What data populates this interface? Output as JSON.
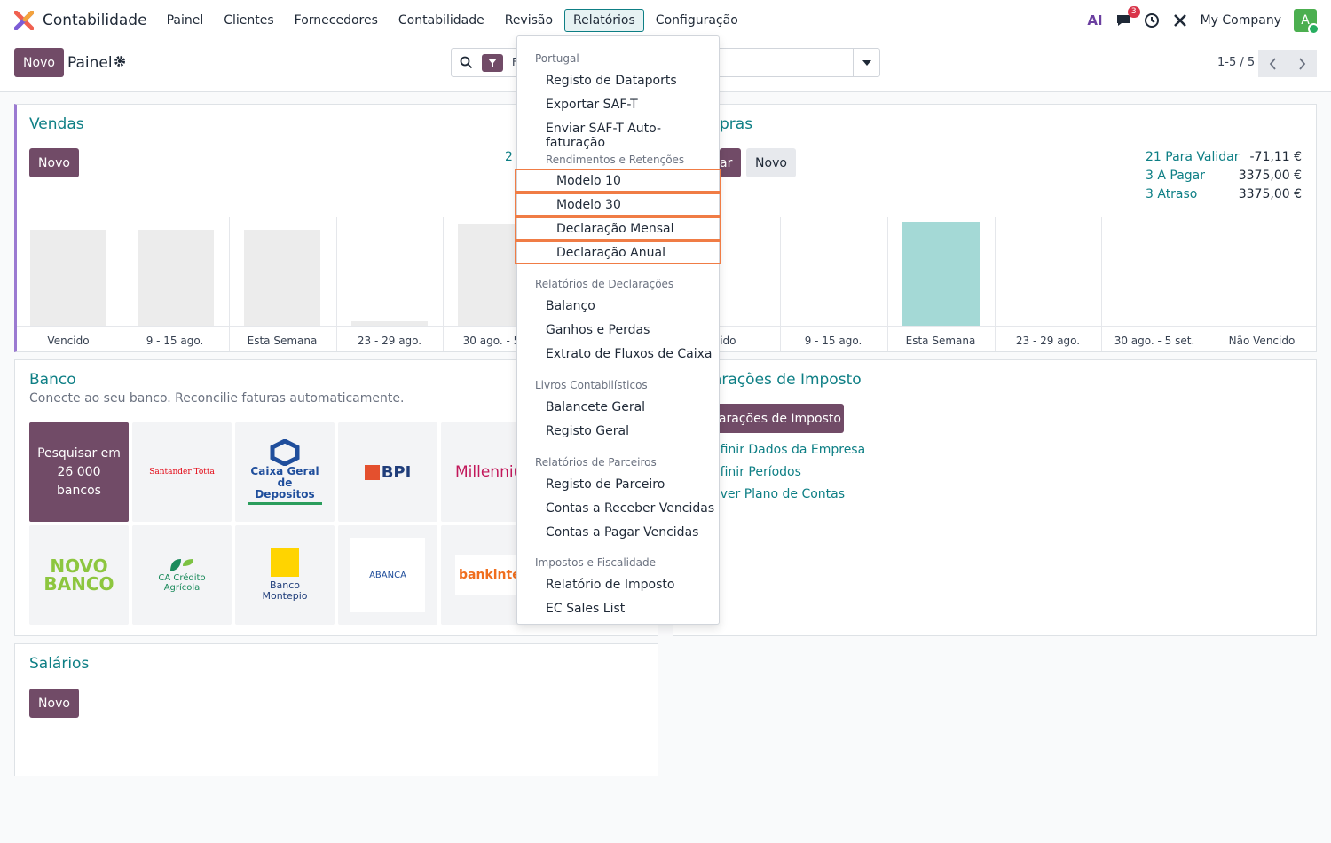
{
  "navbar": {
    "app_name": "Contabilidade",
    "menu": [
      "Painel",
      "Clientes",
      "Fornecedores",
      "Contabilidade",
      "Revisão",
      "Relatórios",
      "Configuração"
    ],
    "active_menu": "Relatórios",
    "ai_label": "AI",
    "chat_count": "3",
    "company": "My Company",
    "avatar_letter": "A"
  },
  "control": {
    "new_label": "Novo",
    "title": "Painel",
    "filter_text": "F",
    "pager": "1-5 / 5"
  },
  "sales": {
    "title": "Vendas",
    "new_label": "Novo",
    "partial_text": "2 I",
    "bar_labels": [
      "Vencido",
      "9 - 15 ago.",
      "Esta Semana",
      "23 - 29 ago.",
      "30 ago. - 5 s"
    ]
  },
  "purchases": {
    "title_partial": "pras",
    "upload_partial": "ar",
    "new_label": "Novo",
    "kpis": [
      {
        "label": "21 Para Validar",
        "value": "-71,11 €"
      },
      {
        "label": "3 A Pagar",
        "value": "3375,00 €"
      },
      {
        "label": "3 Atraso",
        "value": "3375,00 €"
      }
    ],
    "bar_labels": [
      "ncido",
      "9 - 15 ago.",
      "Esta Semana",
      "23 - 29 ago.",
      "30 ago. - 5 set.",
      "Não Vencido"
    ]
  },
  "bank": {
    "title": "Banco",
    "subtitle": "Conecte ao seu banco. Reconcilie faturas automaticamente.",
    "search_banks": "Pesquisar em 26 000 bancos",
    "banks": [
      "Santander Totta",
      "Caixa Geral de Depositos",
      "BPI",
      "Millenniu",
      "NOVO BANCO",
      "CA Crédito Agrícola",
      "Banco Montepio",
      "ABANCA",
      "bankinte"
    ]
  },
  "tax": {
    "title_partial": "arações de Imposto",
    "button_partial": "larações de Imposto",
    "links": [
      "efinir Dados da Empresa",
      "efinir Períodos",
      "ever Plano de Contas"
    ]
  },
  "salaries": {
    "title": "Salários",
    "new_label": "Novo"
  },
  "dropdown": {
    "portugal_header": "Portugal",
    "portugal_items": [
      "Registo de Dataports",
      "Exportar SAF-T",
      "Enviar SAF-T Auto-faturação"
    ],
    "rendimentos_header": "Rendimentos e Retenções",
    "rendimentos_items": [
      "Modelo 10",
      "Modelo 30",
      "Declaração Mensal",
      "Declaração Anual"
    ],
    "declaracoes_header": "Relatórios de Declarações",
    "declaracoes_items": [
      "Balanço",
      "Ganhos e Perdas",
      "Extrato de Fluxos de Caixa"
    ],
    "livros_header": "Livros Contabilísticos",
    "livros_items": [
      "Balancete Geral",
      "Registo Geral"
    ],
    "parceiros_header": "Relatórios de Parceiros",
    "parceiros_items": [
      "Registo de Parceiro",
      "Contas a Receber Vencidas",
      "Contas a Pagar Vencidas"
    ],
    "impostos_header": "Impostos e Fiscalidade",
    "impostos_items": [
      "Relatório de Imposto",
      "EC Sales List"
    ]
  },
  "colors": {
    "brand": "#714b67",
    "link": "#0e7f85",
    "highlight": "#f07c45",
    "bar_gray": "#ececec",
    "bar_teal": "#a4d9d6"
  }
}
